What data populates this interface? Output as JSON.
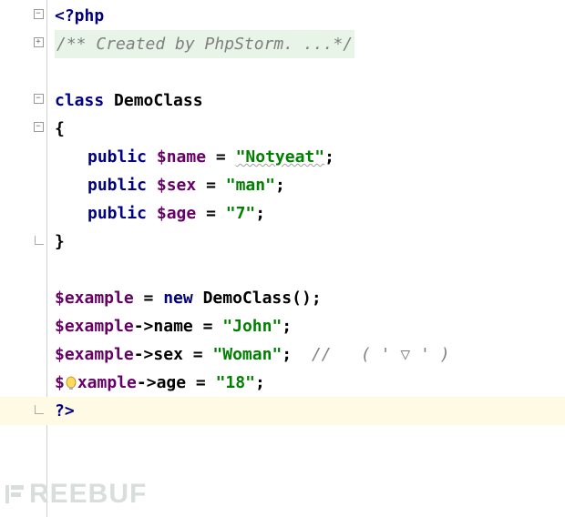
{
  "code": {
    "php_open": "<?php",
    "docblock_open": "/**",
    "docblock_text": " Created by PhpStorm. ...",
    "docblock_close": "*/",
    "kw_class": "class",
    "class_name": "DemoClass",
    "brace_open": "{",
    "brace_close": "}",
    "kw_public": "public",
    "prop_name": "$name",
    "prop_sex": "$sex",
    "prop_age": "$age",
    "val_notyeat": "\"Notyeat\"",
    "val_man": "\"man\"",
    "val_7": "\"7\"",
    "var_example": "$example",
    "kw_new": "new",
    "eq": " = ",
    "arrow": "->",
    "member_name": "name",
    "member_sex": "sex",
    "member_age": "age",
    "val_john": "\"John\"",
    "val_woman": "\"Woman\"",
    "val_18": "\"18\"",
    "semi": ";",
    "parens": "()",
    "inline_comment": "//   ( ' ▽ ' )",
    "php_close": "?>"
  },
  "gutter": {
    "fold_minus": "−",
    "fold_plus": "+"
  },
  "watermark": "REEBUF"
}
